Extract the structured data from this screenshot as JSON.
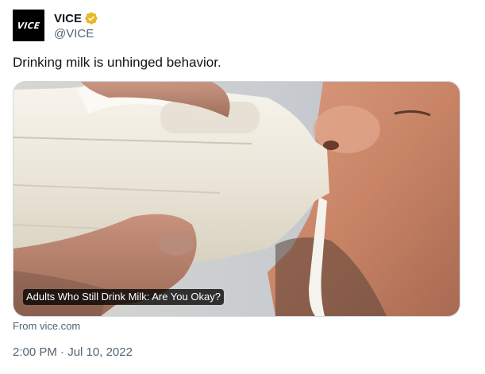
{
  "tweet": {
    "author": {
      "display_name": "VICE",
      "handle": "@VICE",
      "avatar_text": "VICE",
      "verified_icon": "gold-verified-badge-icon"
    },
    "text": "Drinking milk is unhinged behavior.",
    "card": {
      "title": "Adults Who Still Drink Milk: Are You Okay?",
      "source": "From vice.com"
    },
    "time": "2:00 PM",
    "separator": " · ",
    "date": "Jul 10, 2022"
  },
  "colors": {
    "text_primary": "#0f1419",
    "text_secondary": "#536471",
    "verified_gold": "#e8b829",
    "border": "#cfd9de"
  }
}
